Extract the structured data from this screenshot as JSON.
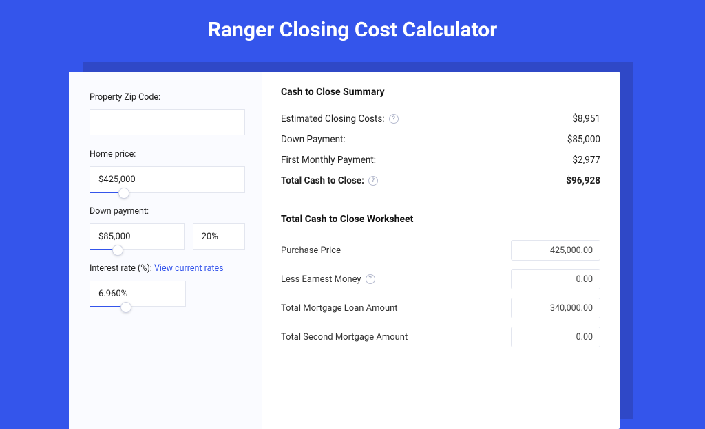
{
  "title": "Ranger Closing Cost Calculator",
  "left": {
    "zip_label": "Property Zip Code:",
    "zip_value": "",
    "home_label": "Home price:",
    "home_value": "$425,000",
    "home_fill_pct": 22,
    "down_label": "Down payment:",
    "down_value": "$85,000",
    "down_pct": "20%",
    "down_fill_pct": 30,
    "rate_label": "Interest rate (%):",
    "rate_link": "View current rates",
    "rate_value": "6.960%",
    "rate_fill_pct": 38
  },
  "summary": {
    "heading": "Cash to Close Summary",
    "rows": [
      {
        "label": "Estimated Closing Costs:",
        "help": true,
        "value": "$8,951"
      },
      {
        "label": "Down Payment:",
        "help": false,
        "value": "$85,000"
      },
      {
        "label": "First Monthly Payment:",
        "help": false,
        "value": "$2,977"
      }
    ],
    "total_label": "Total Cash to Close:",
    "total_value": "$96,928"
  },
  "worksheet": {
    "heading": "Total Cash to Close Worksheet",
    "rows": [
      {
        "label": "Purchase Price",
        "help": false,
        "value": "425,000.00"
      },
      {
        "label": "Less Earnest Money",
        "help": true,
        "value": "0.00"
      },
      {
        "label": "Total Mortgage Loan Amount",
        "help": false,
        "value": "340,000.00"
      },
      {
        "label": "Total Second Mortgage Amount",
        "help": false,
        "value": "0.00"
      }
    ]
  }
}
